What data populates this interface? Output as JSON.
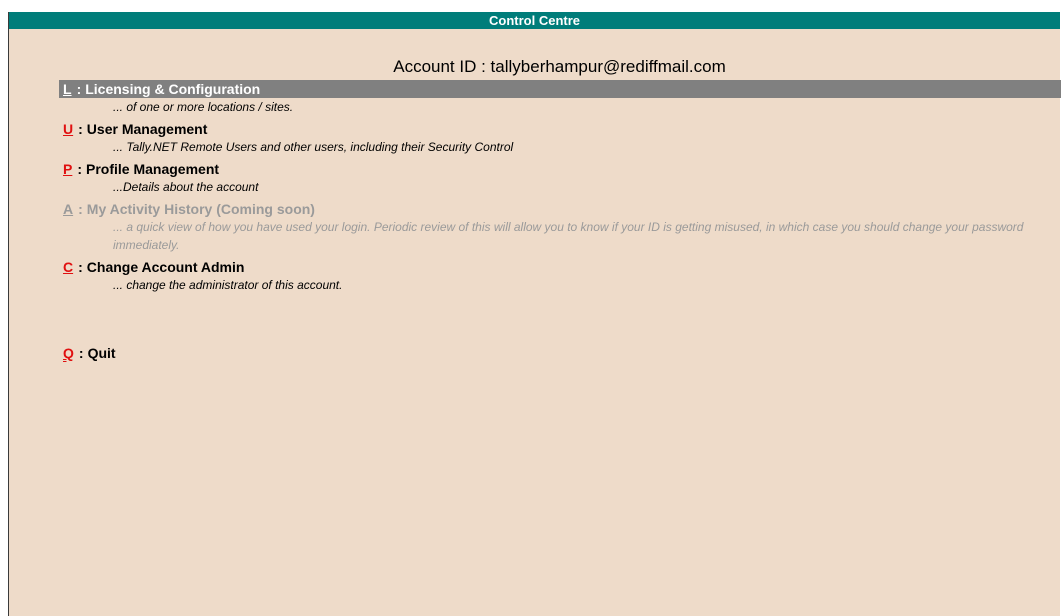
{
  "window": {
    "title": "Control Centre"
  },
  "account": {
    "label": "Account ID : tallyberhampur@rediffmail.com"
  },
  "menu": {
    "separator": ":",
    "items": [
      {
        "key": "L",
        "label": "Licensing & Configuration",
        "description": "... of one or more locations / sites.",
        "selected": true,
        "enabled": true
      },
      {
        "key": "U",
        "label": "User Management",
        "description": "... Tally.NET Remote Users and other users, including their Security Control",
        "selected": false,
        "enabled": true
      },
      {
        "key": "P",
        "label": "Profile Management",
        "description": "...Details about the account",
        "selected": false,
        "enabled": true
      },
      {
        "key": "A",
        "label": "My Activity History (Coming soon)",
        "description": "... a quick view of how you have used your login. Periodic review of this will allow you to know if your ID is getting misused, in which case you should change your password immediately.",
        "selected": false,
        "enabled": false
      },
      {
        "key": "C",
        "label": "Change Account Admin",
        "description": "... change the administrator of this account.",
        "selected": false,
        "enabled": true
      },
      {
        "key": "Q",
        "label": "Quit",
        "description": "",
        "selected": false,
        "enabled": true
      }
    ]
  },
  "colors": {
    "title_bar": "#007d7a",
    "background": "#eedbc9",
    "selected_bar": "#808080",
    "hotkey": "#e01010",
    "disabled_text": "#9a9a9a"
  }
}
